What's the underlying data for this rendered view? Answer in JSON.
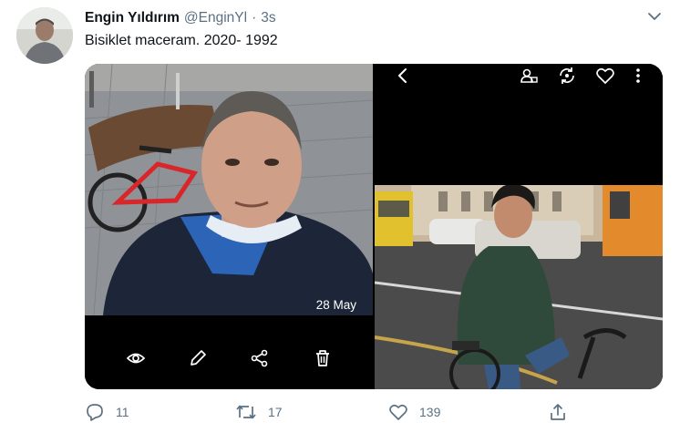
{
  "tweet": {
    "author_name": "Engin Yıldırım",
    "handle": "@EnginYl",
    "separator": "·",
    "time": "3s",
    "text": "Bisiklet maceram. 2020- 1992"
  },
  "media": {
    "left_photo": {
      "date_label": "28 May"
    }
  },
  "actions": {
    "reply_count": "11",
    "retweet_count": "17",
    "like_count": "139"
  },
  "colors": {
    "text_primary": "#0f1419",
    "text_secondary": "#5b7083"
  }
}
